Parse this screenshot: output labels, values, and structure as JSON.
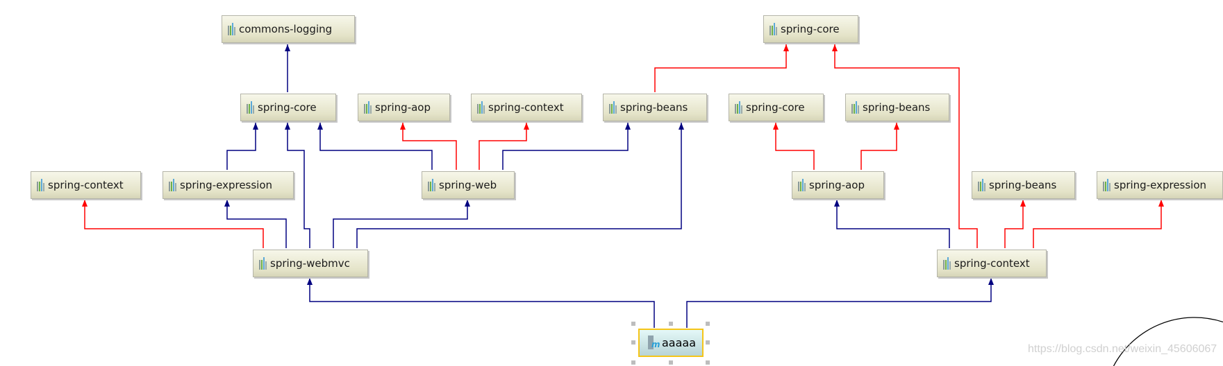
{
  "colors": {
    "compile_edge": "#000080",
    "conflict_edge": "#ff0000",
    "selected_border": "#f5c518"
  },
  "nodes": {
    "commons_logging": "commons-logging",
    "spring_core_l": "spring-core",
    "spring_aop_top": "spring-aop",
    "spring_context_top": "spring-context",
    "spring_beans_top": "spring-beans",
    "spring_core_r2": "spring-core",
    "spring_beans_r2": "spring-beans",
    "spring_core_top": "spring-core",
    "spring_context_l": "spring-context",
    "spring_expression_l": "spring-expression",
    "spring_web": "spring-web",
    "spring_aop_r": "spring-aop",
    "spring_beans_r3": "spring-beans",
    "spring_expression_r": "spring-expression",
    "spring_webmvc": "spring-webmvc",
    "spring_context_r": "spring-context",
    "root": "aaaaa"
  },
  "watermark": "https://blog.csdn.net/weixin_45606067"
}
